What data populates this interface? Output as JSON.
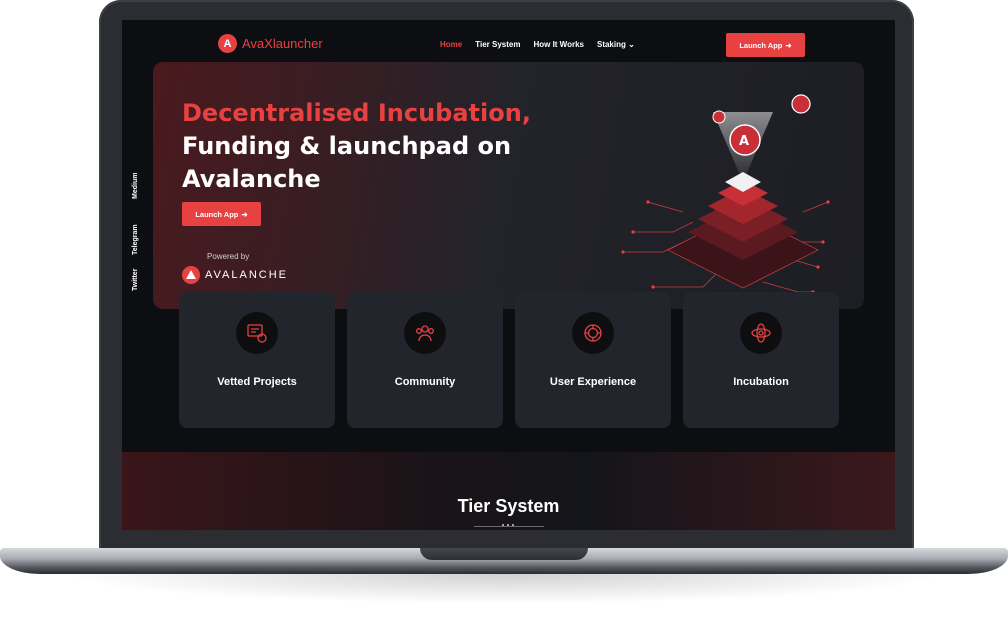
{
  "brand": {
    "name": "AvaXlauncher",
    "logo_letter": "A",
    "accent": "#e84142"
  },
  "nav": {
    "links": [
      {
        "label": "Home",
        "active": true
      },
      {
        "label": "Tier System",
        "active": false
      },
      {
        "label": "How It Works",
        "active": false
      },
      {
        "label": "Staking",
        "active": false,
        "icon": "chevron-down-icon"
      }
    ],
    "cta_label": "Launch App"
  },
  "social": [
    "Medium",
    "Telegram",
    "Twitter"
  ],
  "hero": {
    "title_line1": "Decentralised Incubation,",
    "title_line2": "Funding & launchpad on",
    "title_line3": "Avalanche",
    "cta_label": "Launch App",
    "powered_by": "Powered by",
    "partner": "AVALANCHE"
  },
  "features": [
    {
      "label": "Vetted Projects",
      "icon": "vetted-projects-icon"
    },
    {
      "label": "Community",
      "icon": "community-icon"
    },
    {
      "label": "User Experience",
      "icon": "user-experience-icon"
    },
    {
      "label": "Incubation",
      "icon": "incubation-icon"
    }
  ],
  "tier": {
    "title": "Tier System"
  }
}
